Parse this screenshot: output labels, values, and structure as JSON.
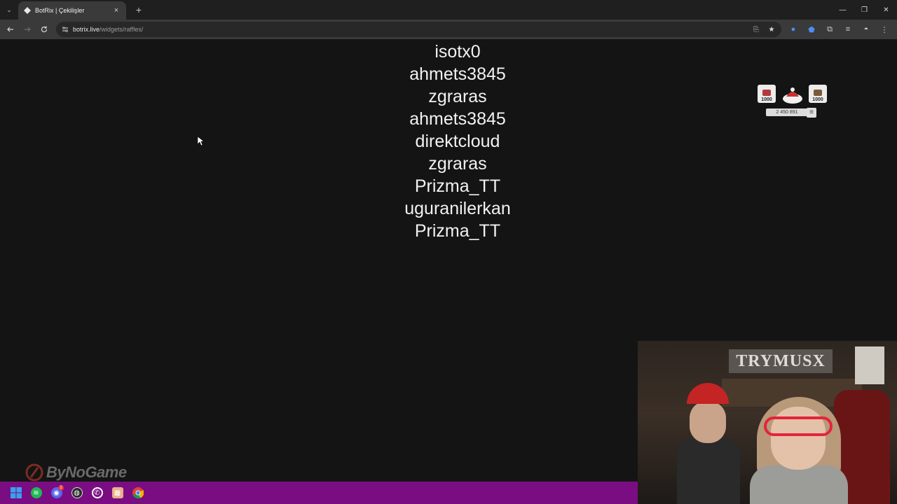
{
  "browser": {
    "tab": {
      "title": "BotRix | Çekilişler",
      "close": "×",
      "favicon": "botrix-diamond-icon"
    },
    "new_tab": "+",
    "window_controls": {
      "minimize": "—",
      "maximize": "❐",
      "close": "✕"
    },
    "url_host": "botrix.live",
    "url_path": "/widgets/raffles/"
  },
  "raffle": {
    "entries": [
      "isotx0",
      "ahmets3845",
      "zgraras",
      "ahmets3845",
      "direktcloud",
      "zgraras",
      "Prizma_TT",
      "uguranilerkan",
      "Prizma_TT"
    ]
  },
  "widget": {
    "card_left_value": "1000",
    "card_right_value": "1000",
    "count": "2 450 891"
  },
  "watermark": "ByNoGame",
  "webcam": {
    "sign_text": "TRYMUSX"
  },
  "taskbar": {
    "icons": [
      "windows-start-icon",
      "spotify-icon",
      "discord-icon",
      "obs-icon",
      "whatsapp-icon",
      "image-viewer-icon",
      "chrome-icon"
    ],
    "discord_badge": "2"
  },
  "colors": {
    "taskbar": "#7a0d82",
    "page_bg": "#141414",
    "accent": "#4c8ef7"
  }
}
